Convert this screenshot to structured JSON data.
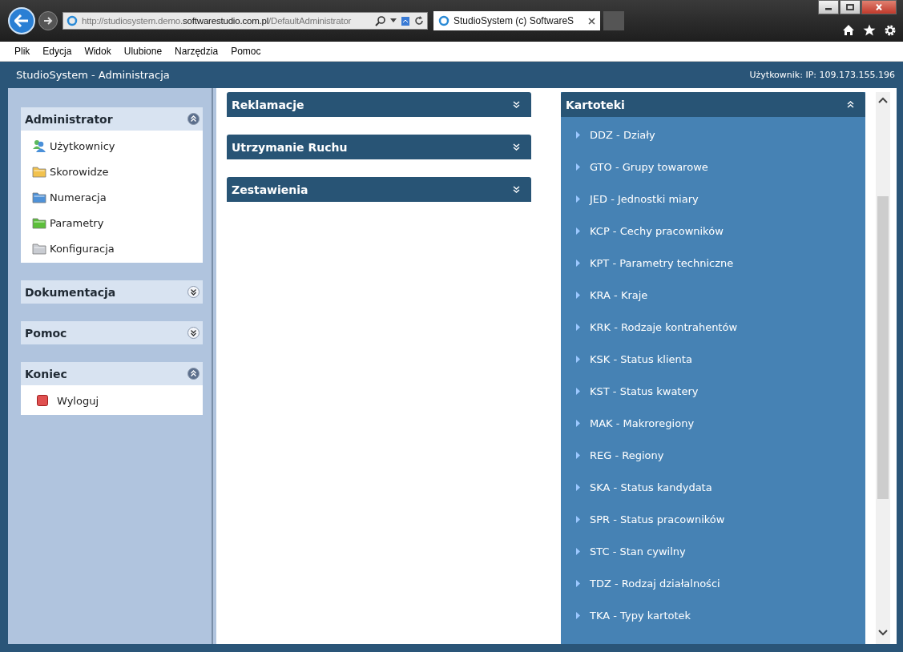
{
  "browser": {
    "address": "http://studiosystem.demo.**softwarestudio.com.pl**/DefaultAdministrator",
    "tab_title": "StudioSystem (c) SoftwareS"
  },
  "menu": [
    "Plik",
    "Edycja",
    "Widok",
    "Ulubione",
    "Narzędzia",
    "Pomoc"
  ],
  "header": {
    "title": "StudioSystem - Administracja",
    "user": "Użytkownik: IP: 109.173.155.196"
  },
  "sidebar": [
    {
      "title": "Administrator",
      "expanded": true,
      "items": [
        {
          "label": "Użytkownicy",
          "kind": "users",
          "color": "#4a90d9"
        },
        {
          "label": "Skorowidze",
          "kind": "folder",
          "color": "#f2c24e"
        },
        {
          "label": "Numeracja",
          "kind": "folder",
          "color": "#4f92d8"
        },
        {
          "label": "Parametry",
          "kind": "folder",
          "color": "#5cbf3a"
        },
        {
          "label": "Konfiguracja",
          "kind": "folder",
          "color": "#c9ccd2"
        }
      ]
    },
    {
      "title": "Dokumentacja",
      "expanded": false
    },
    {
      "title": "Pomoc",
      "expanded": false
    },
    {
      "title": "Koniec",
      "expanded": true,
      "items": [
        {
          "label": "Wyloguj",
          "kind": "logout",
          "color": "#e05050"
        }
      ]
    }
  ],
  "panels": [
    {
      "title": "Reklamacje",
      "expanded": false
    },
    {
      "title": "Utrzymanie Ruchu",
      "expanded": false
    },
    {
      "title": "Zestawienia",
      "expanded": false
    }
  ],
  "kartoteki": {
    "title": "Kartoteki",
    "expanded": true,
    "items": [
      "DDZ - Działy",
      "GTO - Grupy towarowe",
      "JED - Jednostki miary",
      "KCP - Cechy pracowników",
      "KPT - Parametry techniczne",
      "KRA - Kraje",
      "KRK - Rodzaje kontrahentów",
      "KSK - Status klienta",
      "KST - Status kwatery",
      "MAK - Makroregiony",
      "REG - Regiony",
      "SKA - Status kandydata",
      "SPR - Status pracowników",
      "STC - Stan cywilny",
      "TDZ - Rodzaj działalności",
      "TKA - Typy kartotek"
    ]
  }
}
